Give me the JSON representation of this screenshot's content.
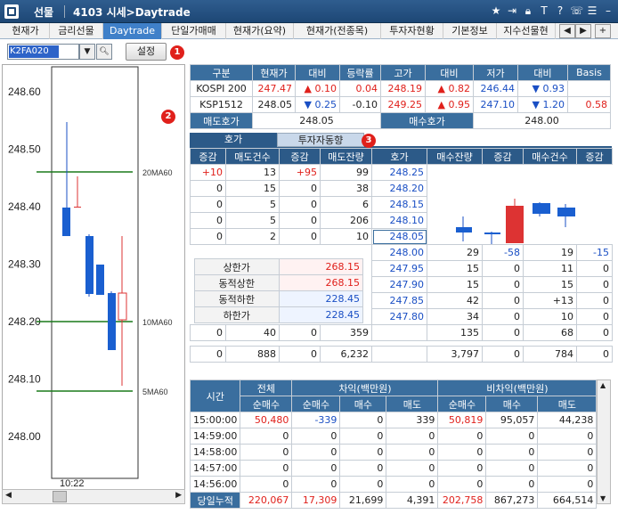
{
  "window": {
    "product": "선물",
    "screen_title": "4103 시세>Daytrade"
  },
  "tabs": [
    "현재가",
    "금리선물",
    "Daytrade",
    "단일가매매",
    "현재가(요약)",
    "현재가(전종목)",
    "투자자현황",
    "기본정보",
    "지수선물현"
  ],
  "active_tab": "Daytrade",
  "toolbar": {
    "code_value": "K2FA020",
    "setup_label": "설정",
    "badge1": "1"
  },
  "chart": {
    "yticks": [
      "248.60",
      "248.50",
      "248.40",
      "248.30",
      "248.20",
      "248.10",
      "248.00"
    ],
    "ma_labels": [
      "20MA60",
      "10MA60",
      "5MA60"
    ],
    "time_label": "10:22",
    "badge2": "2"
  },
  "quote": {
    "headers": [
      "구분",
      "현재가",
      "대비",
      "등락률",
      "고가",
      "대비",
      "저가",
      "대비",
      "Basis"
    ],
    "rows": [
      {
        "name": "KOSPI 200",
        "price": "247.47",
        "dir": "▲",
        "chg": "0.10",
        "rate": "0.04",
        "high": "248.19",
        "hdir": "▲",
        "hchg": "0.82",
        "low": "246.44",
        "ldir": "▼",
        "lchg": "0.93",
        "basis": ""
      },
      {
        "name": "KSP1512",
        "price": "248.05",
        "dir": "▼",
        "chg": "0.25",
        "rate": "-0.10",
        "high": "249.25",
        "hdir": "▲",
        "hchg": "0.95",
        "low": "247.10",
        "ldir": "▼",
        "lchg": "1.20",
        "basis": "0.58"
      }
    ],
    "bid_label": "매도호가",
    "bid_value": "248.05",
    "ask_label": "매수호가",
    "ask_value": "248.00"
  },
  "subtabs": {
    "tab1": "호가",
    "tab2": "투자자동향",
    "badge3": "3"
  },
  "orderbook": {
    "headers": [
      "증감",
      "매도건수",
      "증감",
      "매도잔량",
      "호가",
      "매수잔량",
      "증감",
      "매수건수",
      "증감"
    ],
    "sell": [
      [
        "+10",
        "13",
        "+95",
        "99",
        "248.25"
      ],
      [
        "0",
        "15",
        "0",
        "38",
        "248.20"
      ],
      [
        "0",
        "5",
        "0",
        "6",
        "248.15"
      ],
      [
        "0",
        "5",
        "0",
        "206",
        "248.10"
      ],
      [
        "0",
        "2",
        "0",
        "10",
        "248.05"
      ]
    ],
    "buy": [
      [
        "248.00",
        "29",
        "-58",
        "19",
        "-15"
      ],
      [
        "247.95",
        "15",
        "0",
        "11",
        "0"
      ],
      [
        "247.90",
        "15",
        "0",
        "15",
        "0"
      ],
      [
        "247.85",
        "42",
        "0",
        "+13",
        "0"
      ],
      [
        "247.80",
        "34",
        "0",
        "10",
        "0"
      ]
    ],
    "limits": [
      [
        "상한가",
        "268.15"
      ],
      [
        "동적상한",
        "268.15"
      ],
      [
        "동적하한",
        "228.45"
      ],
      [
        "하한가",
        "228.45"
      ]
    ],
    "sum1": [
      "0",
      "40",
      "0",
      "359",
      "",
      "135",
      "0",
      "68",
      "0"
    ],
    "sum2": [
      "0",
      "888",
      "0",
      "6,232",
      "",
      "3,797",
      "0",
      "784",
      "0"
    ]
  },
  "program": {
    "h_time": "시간",
    "h_total": "전체",
    "h_netbuy": "순매수",
    "h_arb": "차익(백만원)",
    "h_nonarb": "비차익(백만원)",
    "sub": [
      "순매수",
      "매수",
      "매도",
      "순매수",
      "매수",
      "매도"
    ],
    "rows": [
      [
        "15:00:00",
        "50,480",
        "-339",
        "0",
        "339",
        "50,819",
        "95,057",
        "44,238"
      ],
      [
        "14:59:00",
        "0",
        "0",
        "0",
        "0",
        "0",
        "0",
        "0"
      ],
      [
        "14:58:00",
        "0",
        "0",
        "0",
        "0",
        "0",
        "0",
        "0"
      ],
      [
        "14:57:00",
        "0",
        "0",
        "0",
        "0",
        "0",
        "0",
        "0"
      ],
      [
        "14:56:00",
        "0",
        "0",
        "0",
        "0",
        "0",
        "0",
        "0"
      ]
    ],
    "total": [
      "당일누적",
      "220,067",
      "17,309",
      "21,699",
      "4,391",
      "202,758",
      "867,273",
      "664,514"
    ]
  }
}
